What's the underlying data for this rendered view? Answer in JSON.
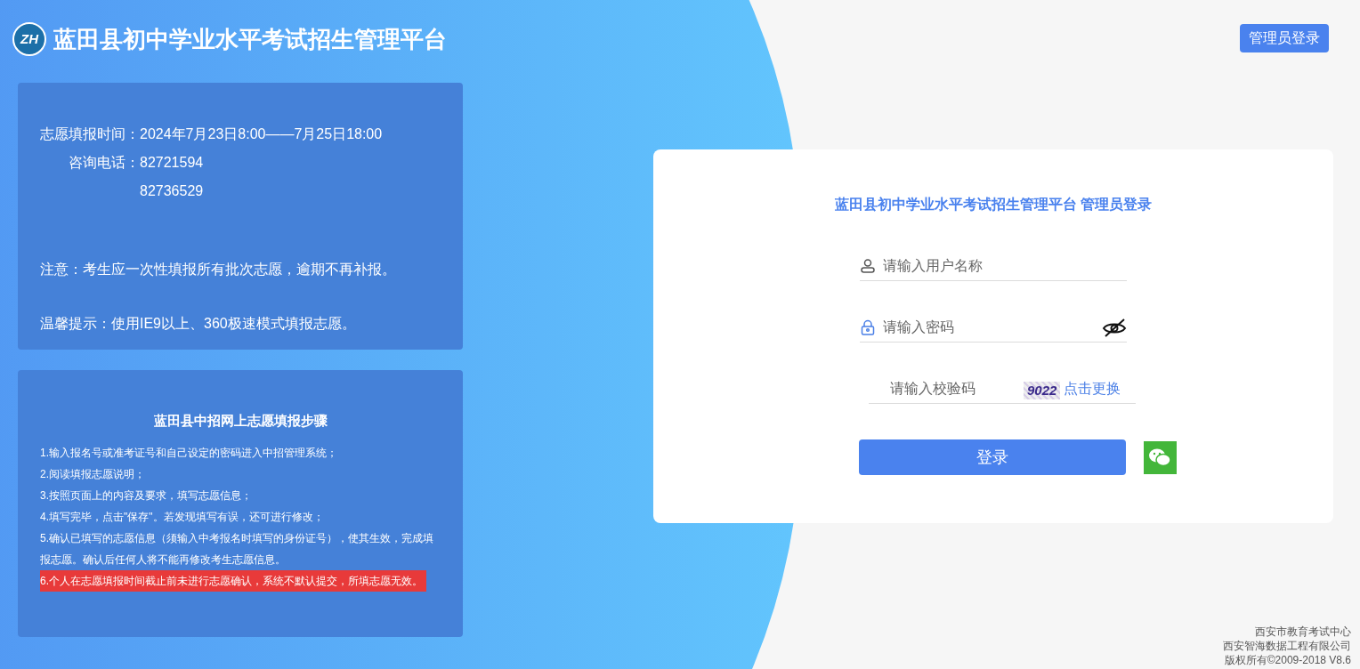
{
  "header": {
    "logo_text": "ZH",
    "title": "蓝田县初中学业水平考试招生管理平台",
    "admin_button": "管理员登录"
  },
  "info_panel": {
    "lines": [
      {
        "label": "志愿填报时间：",
        "value": "2024年7月23日8:00——7月25日18:00"
      },
      {
        "label": "咨询电话：",
        "value": "82721594"
      },
      {
        "value": "82736529"
      }
    ],
    "notice": "注意：考生应一次性填报所有批次志愿，逾期不再补报。",
    "tip": "温馨提示：使用IE9以上、360极速模式填报志愿。"
  },
  "steps_panel": {
    "title": "蓝田县中招网上志愿填报步骤",
    "steps": [
      {
        "text": "1.输入报名号或准考证号和自己设定的密码进入中招管理系统；",
        "highlighted": false
      },
      {
        "text": "2.阅读填报志愿说明；",
        "highlighted": false
      },
      {
        "text": "3.按照页面上的内容及要求，填写志愿信息；",
        "highlighted": false
      },
      {
        "text": "4.填写完毕，点击\"保存\"。若发现填写有误，还可进行修改；",
        "highlighted": false
      },
      {
        "text": "5.确认已填写的志愿信息（须输入中考报名时填写的身份证号），使其生效，完成填报志愿。确认后任何人将不能再修改考生志愿信息。",
        "highlighted": false
      },
      {
        "text": "6.个人在志愿填报时间截止前未进行志愿确认，系统不默认提交，所填志愿无效。",
        "highlighted": true
      }
    ]
  },
  "login": {
    "title": "蓝田县初中学业水平考试招生管理平台 管理员登录",
    "fields": [
      {
        "kind": "username",
        "placeholder": "请输入用户名称"
      },
      {
        "kind": "password",
        "placeholder": "请输入密码"
      },
      {
        "kind": "captcha",
        "placeholder": "请输入校验码",
        "captcha": "9022",
        "refresh_link": "点击更换"
      }
    ],
    "submit": "登录"
  },
  "footer": [
    "西安市教育考试中心",
    "西安智海数据工程有限公司",
    "版权所有©2009-2018 V8.6"
  ]
}
